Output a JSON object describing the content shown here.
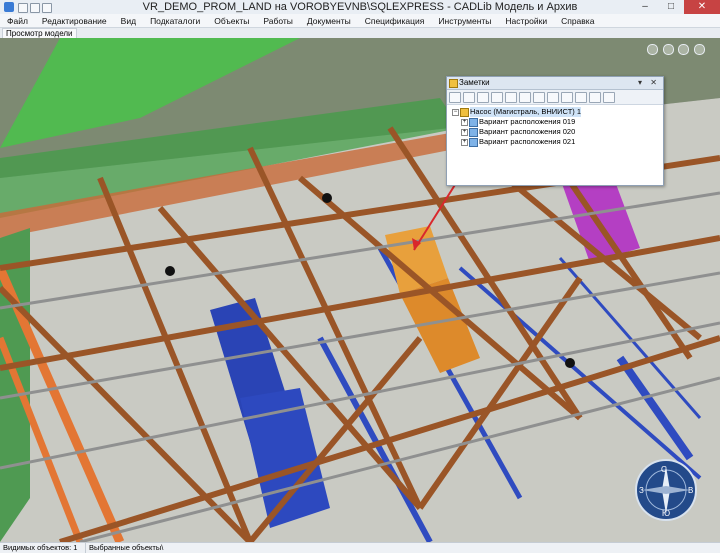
{
  "window": {
    "title": "VR_DEMO_PROM_LAND на VOROBYEVNB\\SQLEXPRESS - CADLib Модель и Архив",
    "controls": {
      "minimize": "–",
      "maximize": "□",
      "close": "✕"
    }
  },
  "menu": {
    "items": [
      "Файл",
      "Редактирование",
      "Вид",
      "Подкаталоги",
      "Объекты",
      "Работы",
      "Документы",
      "Спецификация",
      "Инструменты",
      "Настройки",
      "Справка"
    ]
  },
  "tab": {
    "label": "Просмотр модели"
  },
  "notes_panel": {
    "title": "Заметки",
    "header_buttons": "▾ ✕",
    "tree": [
      {
        "label": "Насос (Магистраль, ВНИИСТ) 1",
        "expander": "−",
        "selected": true
      },
      {
        "label": "Вариант расположения 019",
        "expander": "+"
      },
      {
        "label": "Вариант расположения 020",
        "expander": "+"
      },
      {
        "label": "Вариант расположения 021",
        "expander": "+"
      }
    ]
  },
  "status": {
    "visible_objects": "Видимых объектов: 1",
    "selected_objects": "Выбранные объекты\\"
  },
  "compass": {
    "letters": {
      "n": "С",
      "e": "В",
      "s": "Ю",
      "w": "З"
    }
  },
  "colors": {
    "floor": "#c8c9c2",
    "steel_beam": "#9e5a2a",
    "pump_orange": "#e59a38",
    "pipe_blue": "#2c46b6",
    "pipe_orange": "#e8783a",
    "green_structure": "#3fae3f",
    "magenta_equipment": "#b23ec0",
    "annotation_red": "#d9272c",
    "compass_blue": "#234a8a"
  },
  "icons": [
    "app-icon",
    "view-cube-icon",
    "pan-hand-icon",
    "compass-icon",
    "note-icon",
    "tree-node-icon"
  ]
}
